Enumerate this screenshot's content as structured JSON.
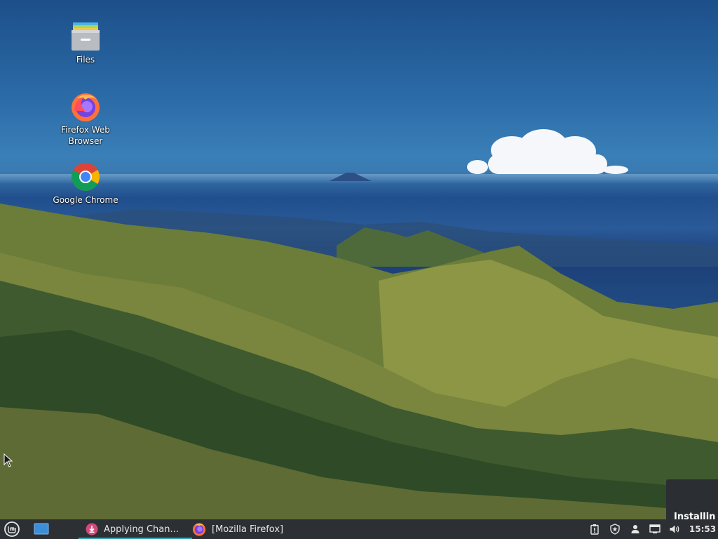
{
  "desktop": {
    "icons": [
      {
        "label": "Files",
        "icon": "files-folder-icon"
      },
      {
        "label": "Firefox Web Browser",
        "icon": "firefox-icon"
      },
      {
        "label": "Google Chrome",
        "icon": "chrome-icon"
      }
    ]
  },
  "notification": {
    "text": "Installin"
  },
  "taskbar": {
    "menu_icon": "linux-mint-menu-icon",
    "show_desktop_icon": "show-desktop-icon",
    "tasks": [
      {
        "label": "Applying Chan...",
        "icon": "update-manager-icon",
        "active": true
      },
      {
        "label": "[Mozilla Firefox]",
        "icon": "firefox-icon",
        "active": false
      }
    ],
    "tray": [
      "clipboard-icon",
      "shield-icon",
      "user-icon",
      "network-icon",
      "volume-icon"
    ],
    "clock": "15:53"
  },
  "colors": {
    "accent": "#35a4b7",
    "panel": "#2c2f33",
    "text": "#e6e6e6"
  }
}
